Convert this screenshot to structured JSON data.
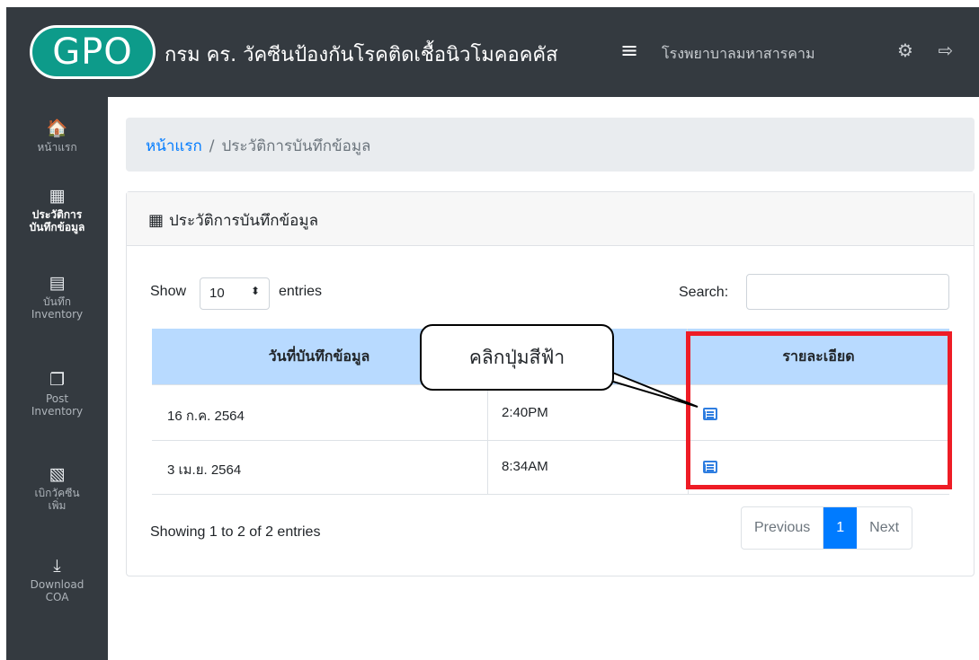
{
  "navbar": {
    "logo_text": "GPO",
    "title": "กรม คร. วัคซีนป้องกันโรคติดเชื้อนิวโมคอคคัส",
    "menu_toggle": "≡",
    "hospital": "โรงพยาบาลมหาสารคาม",
    "settings_icon": "⚙",
    "logout_icon": "⇨"
  },
  "sidebar": {
    "items": [
      {
        "icon": "🏠",
        "label_1": "หน้าแรก",
        "label_2": ""
      },
      {
        "icon": "▦",
        "label_1": "ประวัติการ",
        "label_2": "บันทึกข้อมูล"
      },
      {
        "icon": "▤",
        "label_1": "บันทึก",
        "label_2": "Inventory"
      },
      {
        "icon": "❐",
        "label_1": "Post",
        "label_2": "Inventory"
      },
      {
        "icon": "▧",
        "label_1": "เบิกวัคซีน",
        "label_2": "เพิ่ม"
      },
      {
        "icon": "⤓",
        "label_1": "Download",
        "label_2": "COA"
      }
    ]
  },
  "breadcrumb": {
    "home": "หน้าแรก",
    "separator": "/",
    "current": "ประวัติการบันทึกข้อมูล"
  },
  "card": {
    "title": "ประวัติการบันทึกข้อมูล",
    "title_icon": "▦"
  },
  "table_controls": {
    "show_label": "Show",
    "entries_value": "10",
    "entries_label": "entries",
    "search_label": "Search:",
    "search_value": ""
  },
  "table": {
    "headers": [
      "วันที่บันทึกข้อมูล",
      "",
      "รายละเอียด"
    ],
    "rows": [
      {
        "date": "16 ก.ค. 2564",
        "time": "2:40PM"
      },
      {
        "date": "3 เม.ย. 2564",
        "time": "8:34AM"
      }
    ]
  },
  "footer": {
    "info": "Showing 1 to 2 of 2 entries",
    "previous": "Previous",
    "page": "1",
    "next": "Next"
  },
  "annotation": {
    "callout_text": "คลิกปุ่มสีฟ้า",
    "highlight_color": "#ee1c25"
  },
  "colors": {
    "dark": "#343a40",
    "accent": "#007bff",
    "header_blue": "#b8daff"
  }
}
